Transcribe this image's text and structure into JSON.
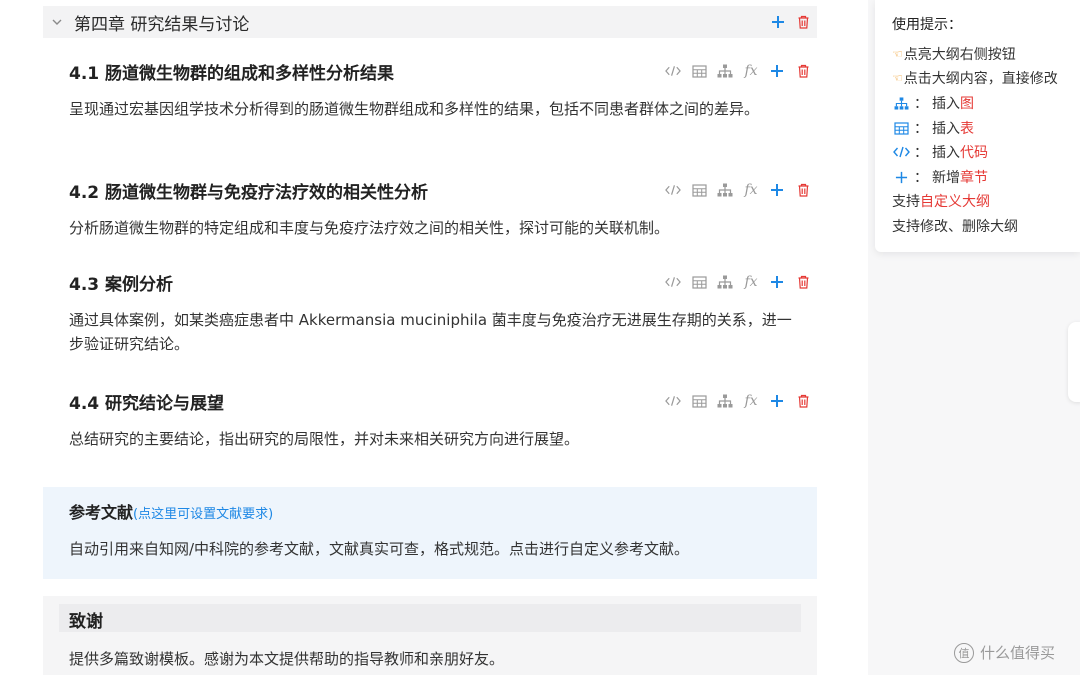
{
  "chapter": {
    "title": "第四章 研究结果与讨论"
  },
  "sections": [
    {
      "title": "4.1 肠道微生物群的组成和多样性分析结果",
      "body": "呈现通过宏基因组学技术分析得到的肠道微生物群组成和多样性的结果，包括不同患者群体之间的差异。"
    },
    {
      "title": "4.2 肠道微生物群与免疫疗法疗效的相关性分析",
      "body": "分析肠道微生物群的特定组成和丰度与免疫疗法疗效之间的相关性，探讨可能的关联机制。"
    },
    {
      "title": "4.3 案例分析",
      "body": "通过具体案例，如某类癌症患者中 Akkermansia muciniphila 菌丰度与免疫治疗无进展生存期的关系，进一步验证研究结论。"
    },
    {
      "title": "4.4 研究结论与展望",
      "body": "总结研究的主要结论，指出研究的局限性，并对未来相关研究方向进行展望。"
    }
  ],
  "icons": {
    "fx": "fx"
  },
  "references": {
    "title": "参考文献",
    "link": "(点这里可设置文献要求)",
    "text": "自动引用来自知网/中科院的参考文献，文献真实可查，格式规范。点击进行自定义参考文献。"
  },
  "acknowledgement": {
    "title": "致谢",
    "text": "提供多篇致谢模板。感谢为本文提供帮助的指导教师和亲朋好友。"
  },
  "tips": {
    "title": "使用提示：",
    "row1": "点亮大纲右侧按钮",
    "row2": "点击大纲内容，直接修改",
    "insert_prefix": "插入",
    "add_prefix": "新增",
    "colon": "：",
    "figure": "图",
    "table": "表",
    "code": "代码",
    "chapter": "章节",
    "support_prefix": "支持",
    "custom_outline": "自定义大纲",
    "row_edit": "支持修改、删除大纲"
  },
  "watermark": {
    "text": "什么值得买",
    "mark": "值"
  },
  "colors": {
    "accent": "#1e88e5",
    "delete": "#e53935",
    "ref_bg": "#eef5fc"
  }
}
